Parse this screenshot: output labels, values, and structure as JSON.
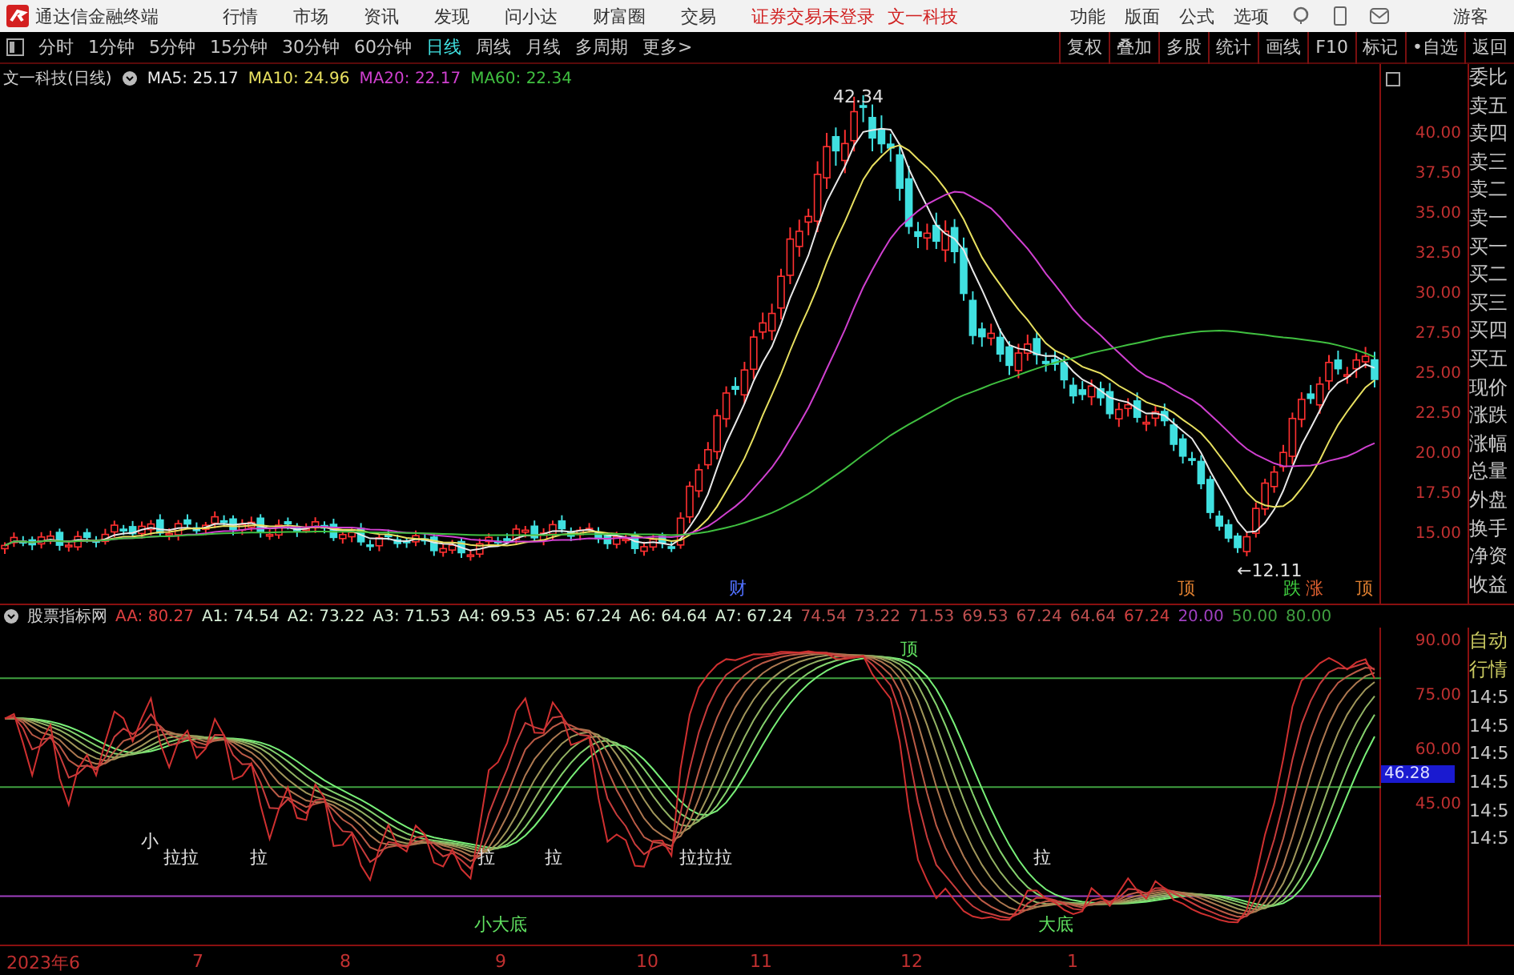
{
  "title_bar": {
    "app_name": "通达信金融终端",
    "menus": [
      "行情",
      "市场",
      "资讯",
      "发现",
      "问小达",
      "财富圈",
      "交易"
    ],
    "notices": [
      "证券交易未登录",
      "文一科技"
    ],
    "tools": [
      "功能",
      "版面",
      "公式",
      "选项"
    ],
    "user": "游客"
  },
  "period_tabs": [
    {
      "label": "分时",
      "selected": false
    },
    {
      "label": "1分钟",
      "selected": false
    },
    {
      "label": "5分钟",
      "selected": false
    },
    {
      "label": "15分钟",
      "selected": false
    },
    {
      "label": "30分钟",
      "selected": false
    },
    {
      "label": "60分钟",
      "selected": false
    },
    {
      "label": "日线",
      "selected": true
    },
    {
      "label": "周线",
      "selected": false
    },
    {
      "label": "月线",
      "selected": false
    },
    {
      "label": "多周期",
      "selected": false
    },
    {
      "label": "更多>",
      "selected": false
    }
  ],
  "chart_tools": [
    "复权",
    "叠加",
    "多股",
    "统计",
    "画线",
    "F10",
    "标记",
    "•自选",
    "返回"
  ],
  "main_chart": {
    "title": "文一科技(日线)",
    "ma": [
      {
        "label": "MA5: 25.17",
        "color": "#e8e8e8"
      },
      {
        "label": "MA10: 24.96",
        "color": "#e8e060"
      },
      {
        "label": "MA20: 22.17",
        "color": "#d040d0"
      },
      {
        "label": "MA60: 22.34",
        "color": "#40c040"
      }
    ],
    "price_labels": [
      "40.00",
      "37.50",
      "35.00",
      "32.50",
      "30.00",
      "27.50",
      "25.00",
      "22.50",
      "20.00",
      "17.50",
      "15.00"
    ],
    "high_label": "42.34",
    "low_label": "←12.11",
    "markers": [
      {
        "text": "财",
        "color": "#5070ff"
      },
      {
        "text": "顶",
        "color": "#e08030"
      },
      {
        "text": "跌",
        "color": "#40d040"
      },
      {
        "text": "涨",
        "color": "#e06030"
      },
      {
        "text": "顶",
        "color": "#e08030"
      }
    ]
  },
  "quote_fields": [
    "委比",
    "卖五",
    "卖四",
    "卖三",
    "卖二",
    "卖一",
    "买一",
    "买二",
    "买三",
    "买四",
    "买五",
    "现价",
    "涨跌",
    "涨幅",
    "总量",
    "外盘",
    "换手",
    "净资",
    "收益"
  ],
  "indicator": {
    "name": "股票指标网",
    "values": [
      {
        "label": "AA: 80.27",
        "color": "#e04040"
      },
      {
        "label": "A1: 74.54",
        "color": "#d8f0d8"
      },
      {
        "label": "A2: 73.22",
        "color": "#d8f0d8"
      },
      {
        "label": "A3: 71.53",
        "color": "#d8f0d8"
      },
      {
        "label": "A4: 69.53",
        "color": "#d8f0d8"
      },
      {
        "label": "A5: 67.24",
        "color": "#d8f0d8"
      },
      {
        "label": "A6: 64.64",
        "color": "#d8f0d8"
      },
      {
        "label": "A7: 67.24",
        "color": "#d8f0d8"
      },
      {
        "label": "74.54",
        "color": "#c05050"
      },
      {
        "label": "73.22",
        "color": "#c05050"
      },
      {
        "label": "71.53",
        "color": "#c05050"
      },
      {
        "label": "69.53",
        "color": "#c05050"
      },
      {
        "label": "67.24",
        "color": "#c05050"
      },
      {
        "label": "64.64",
        "color": "#c05050"
      },
      {
        "label": "67.24",
        "color": "#d04040"
      },
      {
        "label": "20.00",
        "color": "#a040c0"
      },
      {
        "label": "50.00",
        "color": "#40a040"
      },
      {
        "label": "80.00",
        "color": "#40a040"
      }
    ],
    "axis_labels": [
      "90.00",
      "75.00",
      "60.00",
      "45.00"
    ],
    "current": "46.28",
    "signals": [
      {
        "text": "小",
        "color": "#e0e0e0"
      },
      {
        "text": "拉拉",
        "color": "#e0e0e0"
      },
      {
        "text": "拉",
        "color": "#e0e0e0"
      },
      {
        "text": "拉",
        "color": "#e0e0e0"
      },
      {
        "text": "拉",
        "color": "#e0e0e0"
      },
      {
        "text": "拉拉拉",
        "color": "#e0e0e0"
      },
      {
        "text": "拉",
        "color": "#e0e0e0"
      },
      {
        "text": "小大底",
        "color": "#60e060"
      },
      {
        "text": "顶",
        "color": "#60e060"
      },
      {
        "text": "大底",
        "color": "#60e060"
      }
    ]
  },
  "market_panel": {
    "header": [
      "自动",
      "行情"
    ],
    "times": [
      "14:5",
      "14:5",
      "14:5",
      "14:5",
      "14:5",
      "14:5"
    ]
  },
  "dates": [
    "2023年6",
    "7",
    "8",
    "9",
    "10",
    "11",
    "12",
    "1"
  ]
}
